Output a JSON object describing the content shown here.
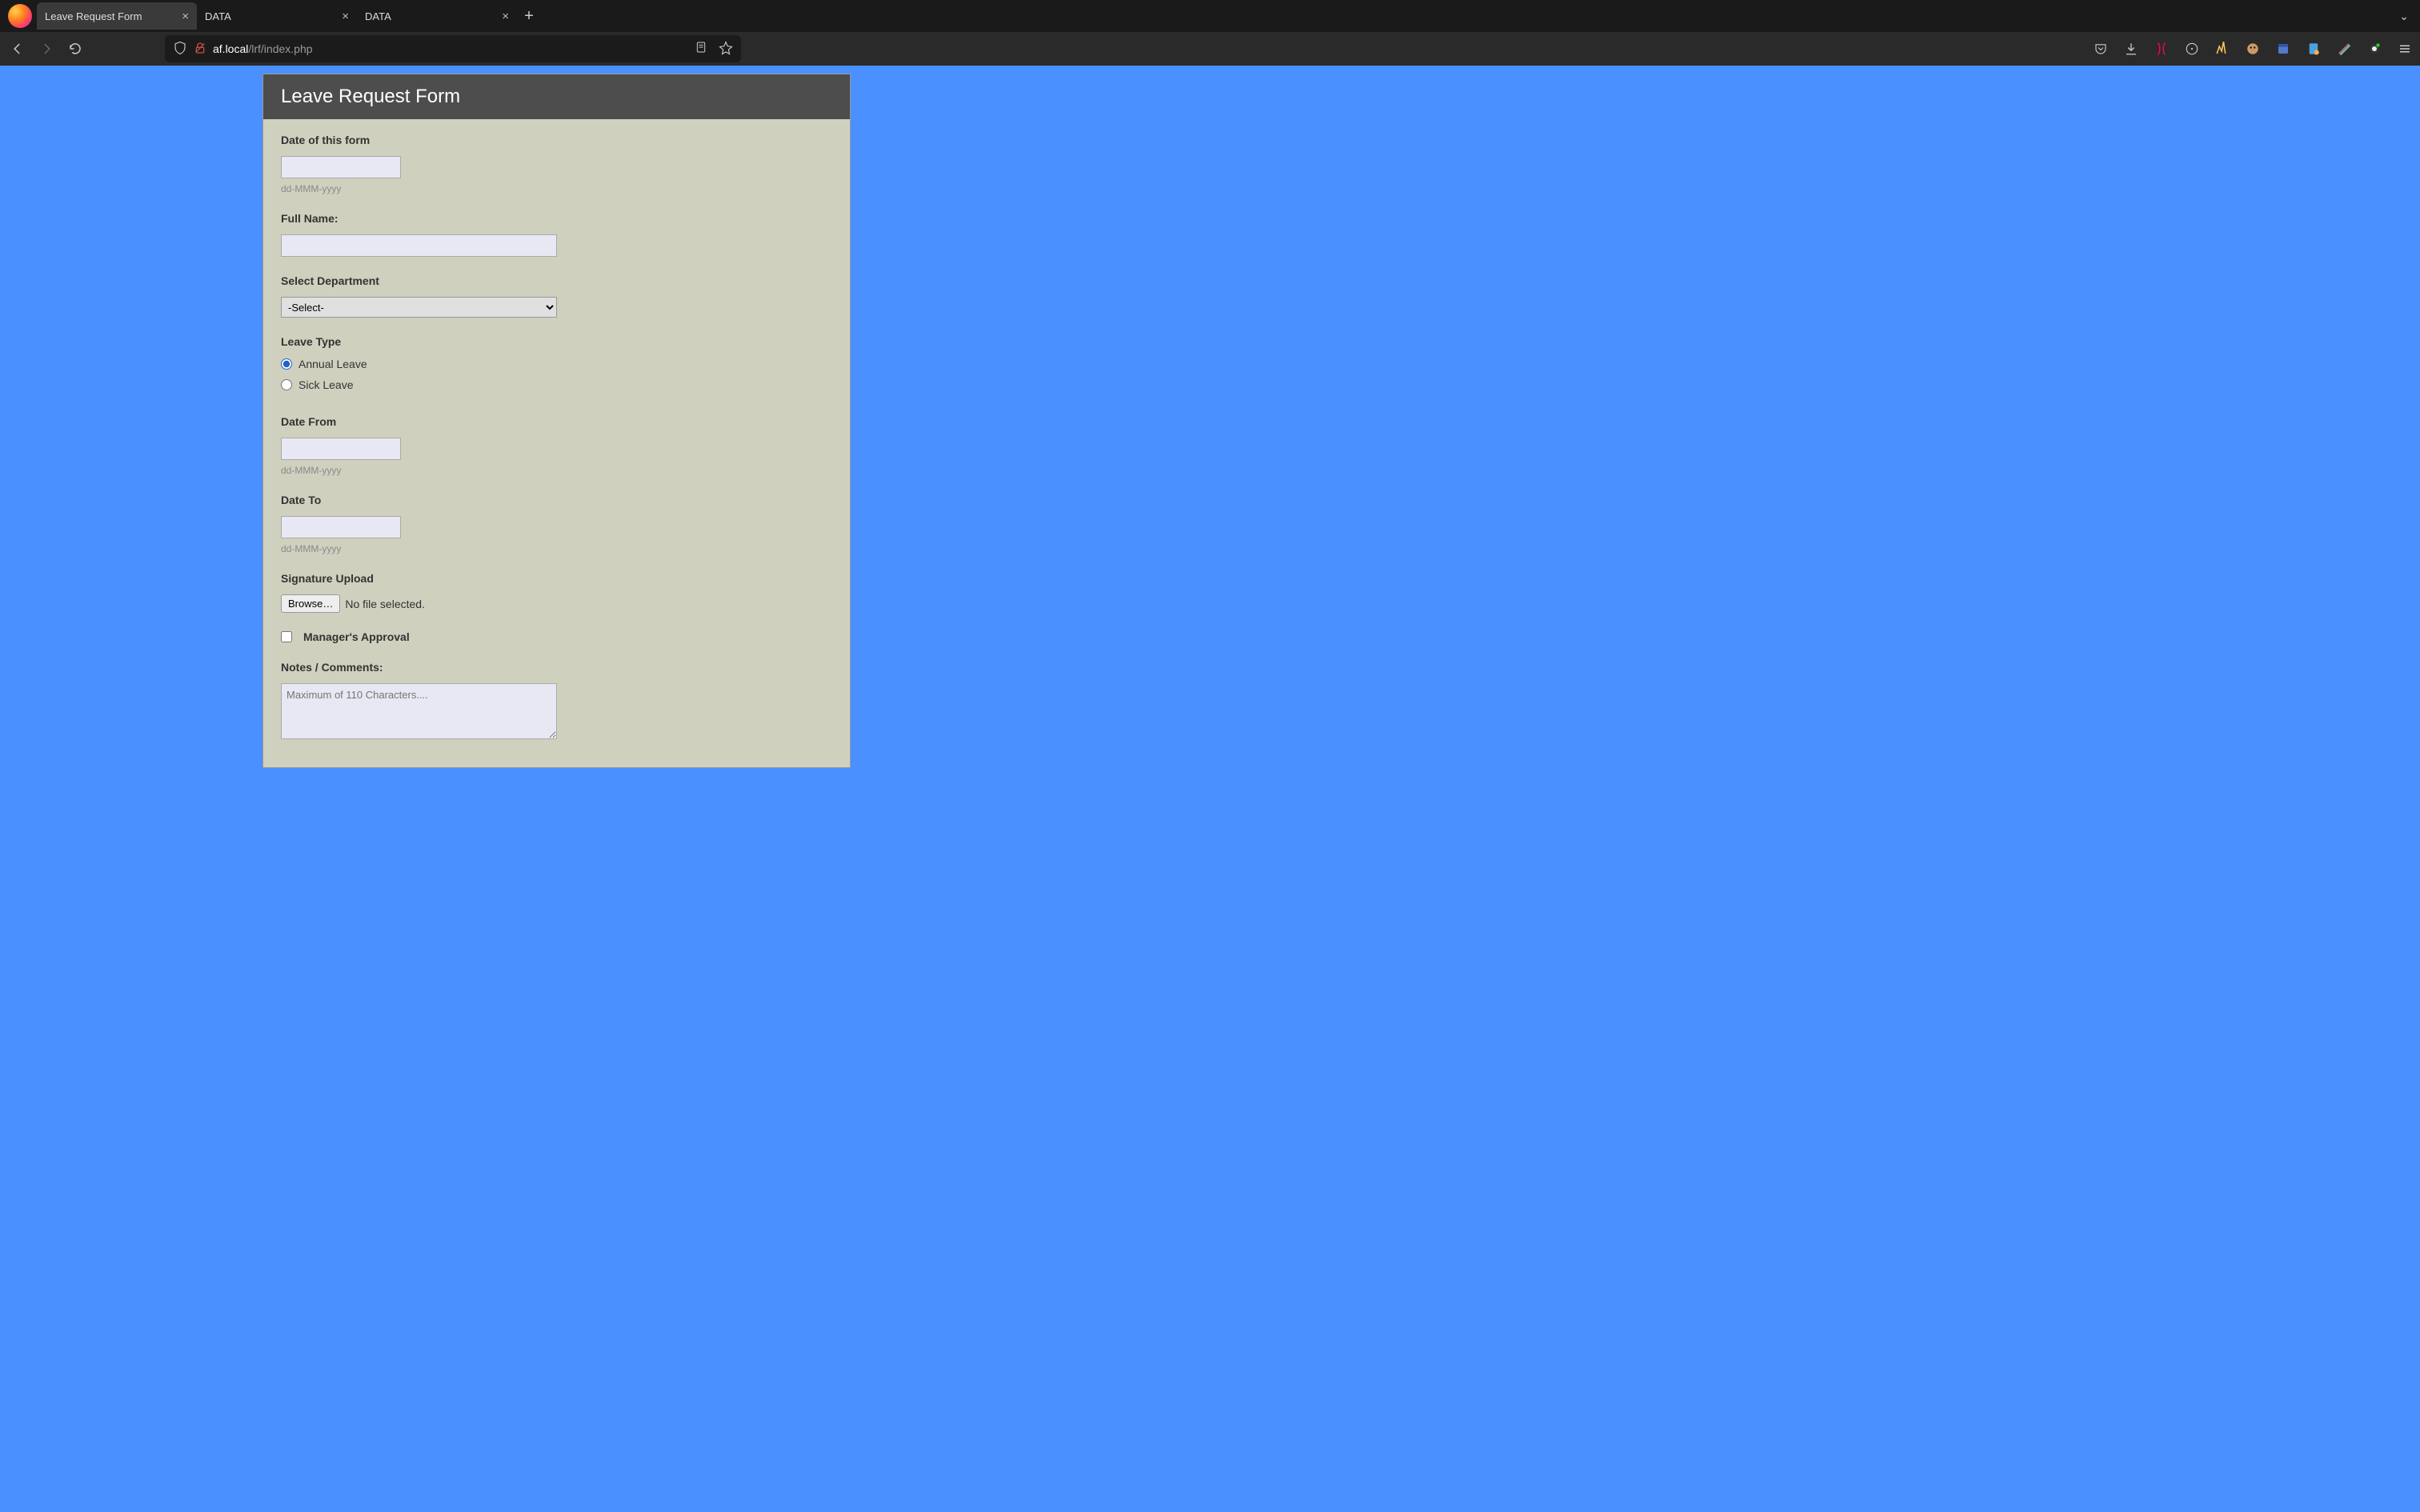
{
  "browser": {
    "tabs": [
      {
        "title": "Leave Request Form",
        "active": true
      },
      {
        "title": "DATA",
        "active": false
      },
      {
        "title": "DATA",
        "active": false
      }
    ],
    "url_host": "af.local",
    "url_path": "/lrf/index.php"
  },
  "form": {
    "title": "Leave Request Form",
    "date_of_form": {
      "label": "Date of this form",
      "value": "",
      "hint": "dd-MMM-yyyy"
    },
    "full_name": {
      "label": "Full Name:",
      "value": ""
    },
    "department": {
      "label": "Select Department",
      "selected": "-Select-"
    },
    "leave_type": {
      "label": "Leave Type",
      "options": [
        {
          "label": "Annual Leave",
          "checked": true
        },
        {
          "label": "Sick Leave",
          "checked": false
        }
      ]
    },
    "date_from": {
      "label": "Date From",
      "value": "",
      "hint": "dd-MMM-yyyy"
    },
    "date_to": {
      "label": "Date To",
      "value": "",
      "hint": "dd-MMM-yyyy"
    },
    "signature": {
      "label": "Signature Upload",
      "browse": "Browse…",
      "status": "No file selected."
    },
    "managers_approval": {
      "label": "Manager's Approval",
      "checked": false
    },
    "notes": {
      "label": "Notes / Comments:",
      "value": "",
      "placeholder": "Maximum of 110 Characters...."
    }
  }
}
